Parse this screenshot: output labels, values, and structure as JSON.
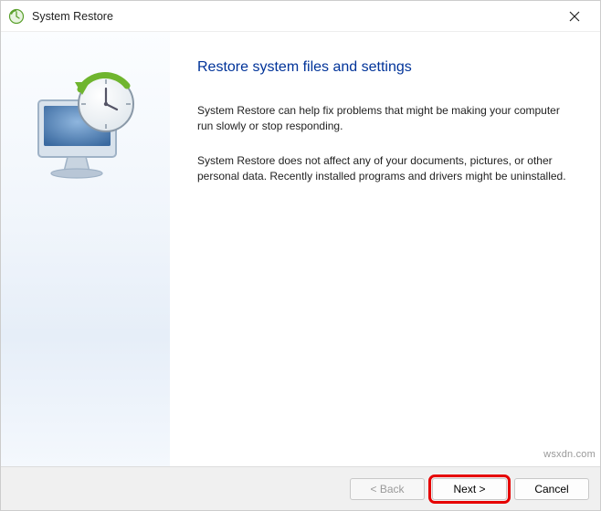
{
  "window": {
    "title": "System Restore"
  },
  "content": {
    "heading": "Restore system files and settings",
    "para1": "System Restore can help fix problems that might be making your computer run slowly or stop responding.",
    "para2": "System Restore does not affect any of your documents, pictures, or other personal data. Recently installed programs and drivers might be uninstalled."
  },
  "footer": {
    "back": "< Back",
    "next": "Next >",
    "cancel": "Cancel"
  },
  "watermark": "wsxdn.com"
}
